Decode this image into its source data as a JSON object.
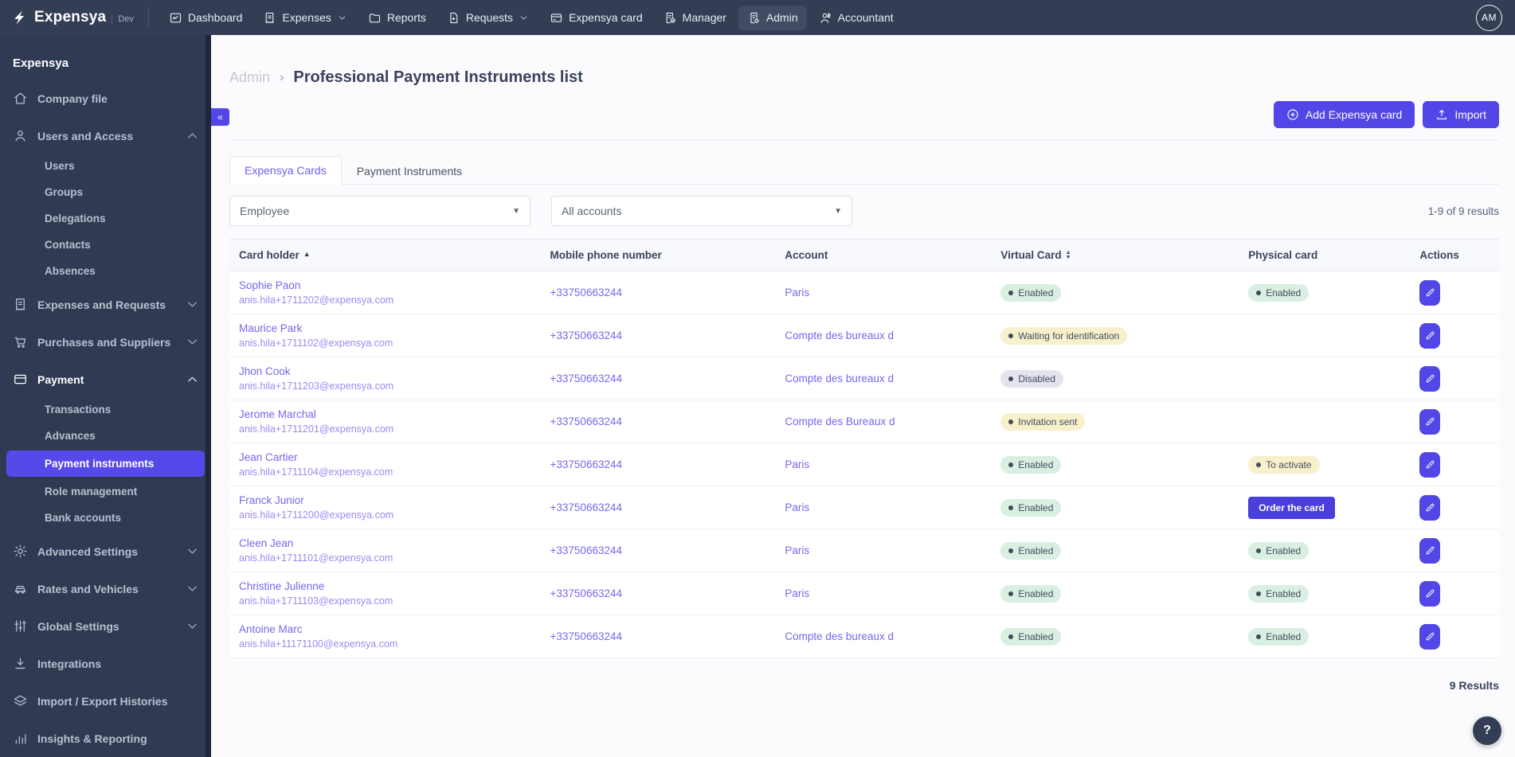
{
  "navbar": {
    "brand": "Expensya",
    "env": "Dev",
    "avatar": "AM",
    "items": [
      {
        "label": "Dashboard",
        "icon": "dashboard-icon",
        "chevron": false,
        "active": false
      },
      {
        "label": "Expenses",
        "icon": "expenses-icon",
        "chevron": true,
        "active": false
      },
      {
        "label": "Reports",
        "icon": "reports-icon",
        "chevron": false,
        "active": false
      },
      {
        "label": "Requests",
        "icon": "requests-icon",
        "chevron": true,
        "active": false
      },
      {
        "label": "Expensya card",
        "icon": "card-icon",
        "chevron": false,
        "active": false
      },
      {
        "label": "Manager",
        "icon": "manager-icon",
        "chevron": false,
        "active": false
      },
      {
        "label": "Admin",
        "icon": "admin-icon",
        "chevron": false,
        "active": true
      },
      {
        "label": "Accountant",
        "icon": "accountant-icon",
        "chevron": false,
        "active": false
      }
    ]
  },
  "sidebar": {
    "title": "Expensya",
    "items": [
      {
        "type": "item",
        "label": "Company file",
        "icon": "home-icon",
        "chevron": null
      },
      {
        "type": "item",
        "label": "Users and Access",
        "icon": "user-icon",
        "chevron": "up"
      },
      {
        "type": "sub",
        "label": "Users"
      },
      {
        "type": "sub",
        "label": "Groups"
      },
      {
        "type": "sub",
        "label": "Delegations"
      },
      {
        "type": "sub",
        "label": "Contacts"
      },
      {
        "type": "sub",
        "label": "Absences"
      },
      {
        "type": "item",
        "label": "Expenses and Requests",
        "icon": "receipt-icon",
        "chevron": "down"
      },
      {
        "type": "item",
        "label": "Purchases and Suppliers",
        "icon": "cart-icon",
        "chevron": "down"
      },
      {
        "type": "item",
        "label": "Payment",
        "icon": "payment-icon",
        "chevron": "up",
        "white": true
      },
      {
        "type": "sub",
        "label": "Transactions"
      },
      {
        "type": "sub",
        "label": "Advances"
      },
      {
        "type": "sub",
        "label": "Payment instruments",
        "active": true
      },
      {
        "type": "sub",
        "label": "Role management"
      },
      {
        "type": "sub",
        "label": "Bank accounts"
      },
      {
        "type": "item",
        "label": "Advanced Settings",
        "icon": "gear-icon",
        "chevron": "down"
      },
      {
        "type": "item",
        "label": "Rates and Vehicles",
        "icon": "car-icon",
        "chevron": "down"
      },
      {
        "type": "item",
        "label": "Global Settings",
        "icon": "sliders-icon",
        "chevron": "down"
      },
      {
        "type": "item",
        "label": "Integrations",
        "icon": "download-icon",
        "chevron": null
      },
      {
        "type": "item",
        "label": "Import / Export Histories",
        "icon": "layers-icon",
        "chevron": null
      },
      {
        "type": "item",
        "label": "Insights & Reporting",
        "icon": "bar-chart-icon",
        "chevron": null
      }
    ]
  },
  "breadcrumb": {
    "section": "Admin",
    "separator": "›",
    "title": "Professional Payment Instruments list"
  },
  "header_actions": {
    "add_card_label": "Add Expensya card",
    "import_label": "Import",
    "collapse_glyph": "«"
  },
  "tabs": [
    {
      "label": "Expensya Cards",
      "active": true
    },
    {
      "label": "Payment Instruments",
      "active": false
    }
  ],
  "filters": {
    "employee": {
      "value": "Employee"
    },
    "accounts": {
      "value": "All accounts"
    },
    "results_summary": "1-9 of 9 results"
  },
  "table": {
    "columns": [
      {
        "label": "Card holder",
        "sort": "asc"
      },
      {
        "label": "Mobile phone number",
        "sort": null
      },
      {
        "label": "Account",
        "sort": null
      },
      {
        "label": "Virtual Card",
        "sort": "both"
      },
      {
        "label": "Physical card",
        "sort": null
      },
      {
        "label": "Actions",
        "sort": null
      }
    ],
    "rows": [
      {
        "name": "Sophie Paon",
        "email": "anis.hila+1711202@expensya.com",
        "phone": "+33750663244",
        "account": "Paris",
        "virtual": {
          "text": "Enabled",
          "variant": "green"
        },
        "physical": {
          "text": "Enabled",
          "variant": "green"
        }
      },
      {
        "name": "Maurice Park",
        "email": "anis.hila+1711102@expensya.com",
        "phone": "+33750663244",
        "account": "Compte des bureaux d",
        "virtual": {
          "text": "Waiting for identification",
          "variant": "yellow"
        },
        "physical": null
      },
      {
        "name": "Jhon Cook",
        "email": "anis.hila+1711203@expensya.com",
        "phone": "+33750663244",
        "account": "Compte des bureaux d",
        "virtual": {
          "text": "Disabled",
          "variant": "gray"
        },
        "physical": null
      },
      {
        "name": "Jerome Marchal",
        "email": "anis.hila+1711201@expensya.com",
        "phone": "+33750663244",
        "account": "Compte des Bureaux d",
        "virtual": {
          "text": "Invitation sent",
          "variant": "yellow"
        },
        "physical": null
      },
      {
        "name": "Jean Cartier",
        "email": "anis.hila+1711104@expensya.com",
        "phone": "+33750663244",
        "account": "Paris",
        "virtual": {
          "text": "Enabled",
          "variant": "green"
        },
        "physical": {
          "text": "To activate",
          "variant": "yellow"
        }
      },
      {
        "name": "Franck Junior",
        "email": "anis.hila+1711200@expensya.com",
        "phone": "+33750663244",
        "account": "Paris",
        "virtual": {
          "text": "Enabled",
          "variant": "green"
        },
        "physical": {
          "text": "Order the card",
          "variant": "button"
        }
      },
      {
        "name": "Cleen Jean",
        "email": "anis.hila+1711101@expensya.com",
        "phone": "+33750663244",
        "account": "Paris",
        "virtual": {
          "text": "Enabled",
          "variant": "green"
        },
        "physical": {
          "text": "Enabled",
          "variant": "green"
        }
      },
      {
        "name": "Christine Julienne",
        "email": "anis.hila+1711103@expensya.com",
        "phone": "+33750663244",
        "account": "Paris",
        "virtual": {
          "text": "Enabled",
          "variant": "green"
        },
        "physical": {
          "text": "Enabled",
          "variant": "green"
        }
      },
      {
        "name": "Antoine Marc",
        "email": "anis.hila+11171100@expensya.com",
        "phone": "+33750663244",
        "account": "Compte des bureaux d",
        "virtual": {
          "text": "Enabled",
          "variant": "green"
        },
        "physical": {
          "text": "Enabled",
          "variant": "green"
        }
      }
    ],
    "footer_results": "9 Results"
  },
  "help": {
    "glyph": "?"
  },
  "colors": {
    "accent": "#5246e6",
    "sidebar_active": "#5649ea",
    "badge_green_bg": "#d8efe2",
    "badge_yellow_bg": "#f8f0cb",
    "badge_gray_bg": "#e3e4ed",
    "navbar_bg": "#333e55",
    "sidebar_bg": "#303b53"
  }
}
